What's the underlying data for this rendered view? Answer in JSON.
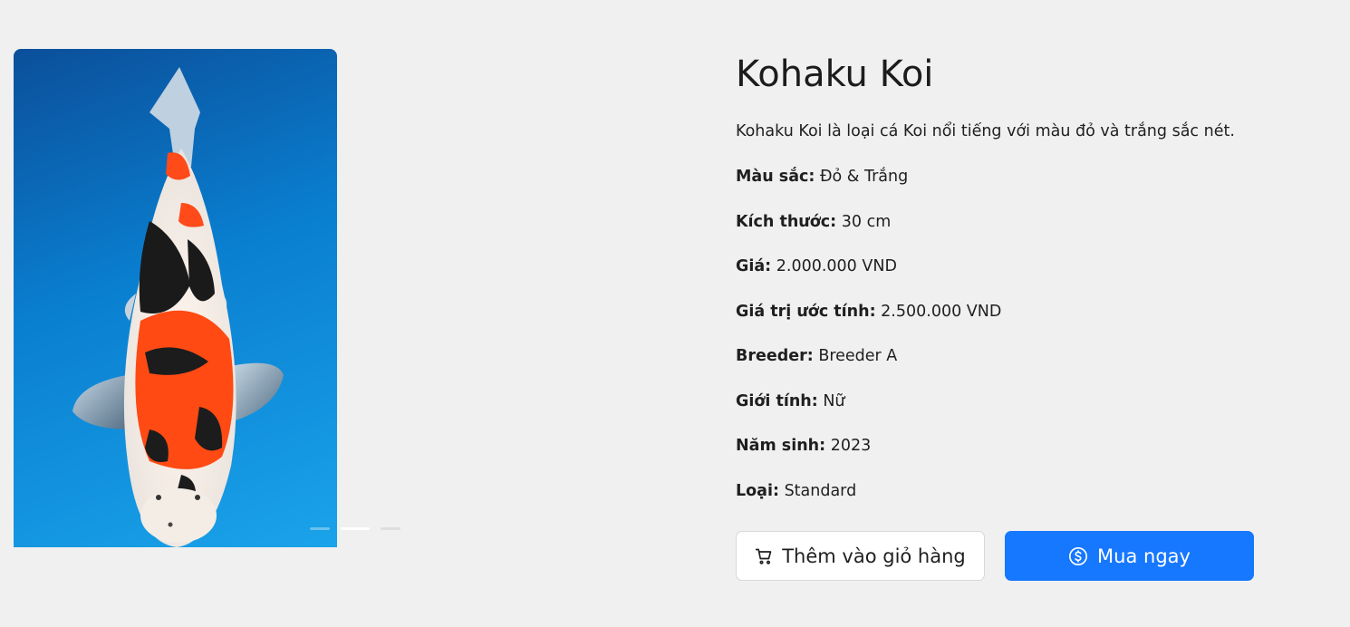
{
  "product": {
    "title": "Kohaku Koi",
    "description": "Kohaku Koi là loại cá Koi nổi tiếng với màu đỏ và trắng sắc nét.",
    "specs": [
      {
        "label": "Màu sắc:",
        "value": "Đỏ & Trắng"
      },
      {
        "label": "Kích thước:",
        "value": "30 cm"
      },
      {
        "label": "Giá:",
        "value": "2.000.000 VND"
      },
      {
        "label": "Giá trị ước tính:",
        "value": "2.500.000 VND"
      },
      {
        "label": "Breeder:",
        "value": "Breeder A"
      },
      {
        "label": "Giới tính:",
        "value": "Nữ"
      },
      {
        "label": "Năm sinh:",
        "value": "2023"
      },
      {
        "label": "Loại:",
        "value": "Standard"
      }
    ]
  },
  "gallery": {
    "image_alt": "koi-fish-photo",
    "active_slide": 2,
    "slide_count": 3
  },
  "actions": {
    "add_to_cart_label": "Thêm vào giỏ hàng",
    "buy_now_label": "Mua ngay"
  },
  "colors": {
    "primary": "#1677ff",
    "background": "#f0f0f0"
  },
  "icons": {
    "cart": "shopping-cart-icon",
    "buy": "dollar-circle-icon"
  }
}
